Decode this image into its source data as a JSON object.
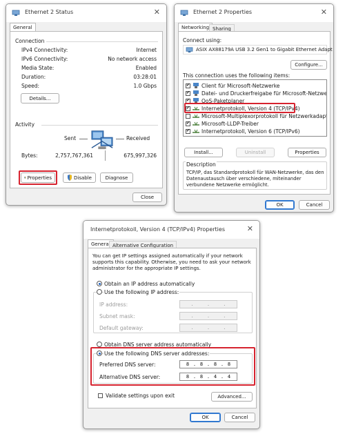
{
  "status_window": {
    "title": "Ethernet 2 Status",
    "tab": "General",
    "connection_label": "Connection",
    "rows": [
      {
        "label": "IPv4 Connectivity:",
        "value": "Internet"
      },
      {
        "label": "IPv6 Connectivity:",
        "value": "No network access"
      },
      {
        "label": "Media State:",
        "value": "Enabled"
      },
      {
        "label": "Duration:",
        "value": "03:28:01"
      },
      {
        "label": "Speed:",
        "value": "1.0 Gbps"
      }
    ],
    "details_label": "Details...",
    "activity_label": "Activity",
    "sent_label": "Sent",
    "received_label": "Received",
    "bytes_label": "Bytes:",
    "bytes_sent": "2,757,767,361",
    "bytes_received": "675,997,326",
    "properties_label": "Properties",
    "disable_label": "Disable",
    "diagnose_label": "Diagnose",
    "close_label": "Close"
  },
  "props_window": {
    "title": "Ethernet 2 Properties",
    "tabs": [
      "Networking",
      "Sharing"
    ],
    "connect_using_label": "Connect using:",
    "adapter": "ASIX AX88179A USB 3.2 Gen1 to Gigabit Ethernet Adapt",
    "configure_label": "Configure...",
    "items_label": "This connection uses the following items:",
    "items": [
      {
        "label": "Client für Microsoft-Netzwerke",
        "checked": true
      },
      {
        "label": "Datei- und Druckerfreigabe für Microsoft-Netzwerke",
        "checked": true
      },
      {
        "label": "QoS-Paketplaner",
        "checked": true
      },
      {
        "label": "Internetprotokoll, Version 4 (TCP/IPv4)",
        "checked": true
      },
      {
        "label": "Microsoft-Multiplexorprotokoll für Netzwerkadapter",
        "checked": false
      },
      {
        "label": "Microsoft-LLDP-Treiber",
        "checked": true
      },
      {
        "label": "Internetprotokoll, Version 6 (TCP/IPv6)",
        "checked": true
      }
    ],
    "install_label": "Install...",
    "uninstall_label": "Uninstall",
    "properties_label": "Properties",
    "description_label": "Description",
    "description_text": "TCP/IP, das Standardprotokoll für WAN-Netzwerke, das den Datenaustausch über verschiedene, miteinander verbundene Netzwerke ermöglicht.",
    "ok_label": "OK",
    "cancel_label": "Cancel"
  },
  "ipv4_window": {
    "title": "Internetprotokoll, Version 4 (TCP/IPv4) Properties",
    "tabs": [
      "General",
      "Alternative Configuration"
    ],
    "intro": "You can get IP settings assigned automatically if your network supports this capability. Otherwise, you need to ask your network administrator for the appropriate IP settings.",
    "obtain_ip_auto": "Obtain an IP address automatically",
    "use_following_ip": "Use the following IP address:",
    "ip_address_label": "IP address:",
    "subnet_mask_label": "Subnet mask:",
    "default_gateway_label": "Default gateway:",
    "obtain_dns_auto": "Obtain DNS server address automatically",
    "use_following_dns": "Use the following DNS server addresses:",
    "preferred_dns_label": "Preferred DNS server:",
    "preferred_dns": [
      "8",
      "8",
      "8",
      "8"
    ],
    "alternative_dns_label": "Alternative DNS server:",
    "alternative_dns": [
      "8",
      "8",
      "4",
      "4"
    ],
    "validate_label": "Validate settings upon exit",
    "advanced_label": "Advanced...",
    "ok_label": "OK",
    "cancel_label": "Cancel"
  },
  "colors": {
    "highlight_red": "#d6222e",
    "accent_blue": "#3078d0"
  }
}
